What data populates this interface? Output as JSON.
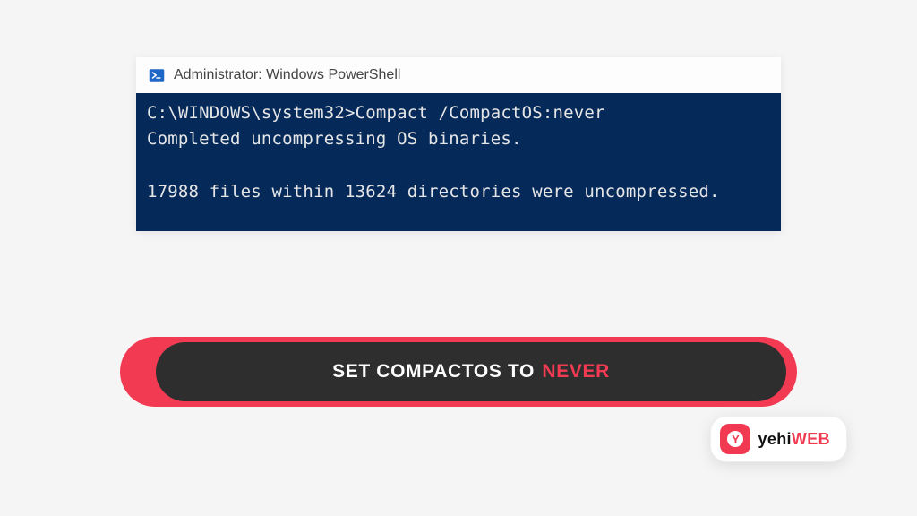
{
  "window": {
    "title": "Administrator: Windows PowerShell"
  },
  "terminal": {
    "prompt": "C:\\WINDOWS\\system32>",
    "command": "Compact /CompactOS:never",
    "line2": "Completed uncompressing OS binaries.",
    "line3": "17988 files within 13624 directories were uncompressed."
  },
  "banner": {
    "lead": "SET COMPACTOS TO ",
    "accent": "NEVER"
  },
  "badge": {
    "glyph": "Y",
    "brand_prefix": "yehi",
    "brand_suffix": "WEB"
  }
}
